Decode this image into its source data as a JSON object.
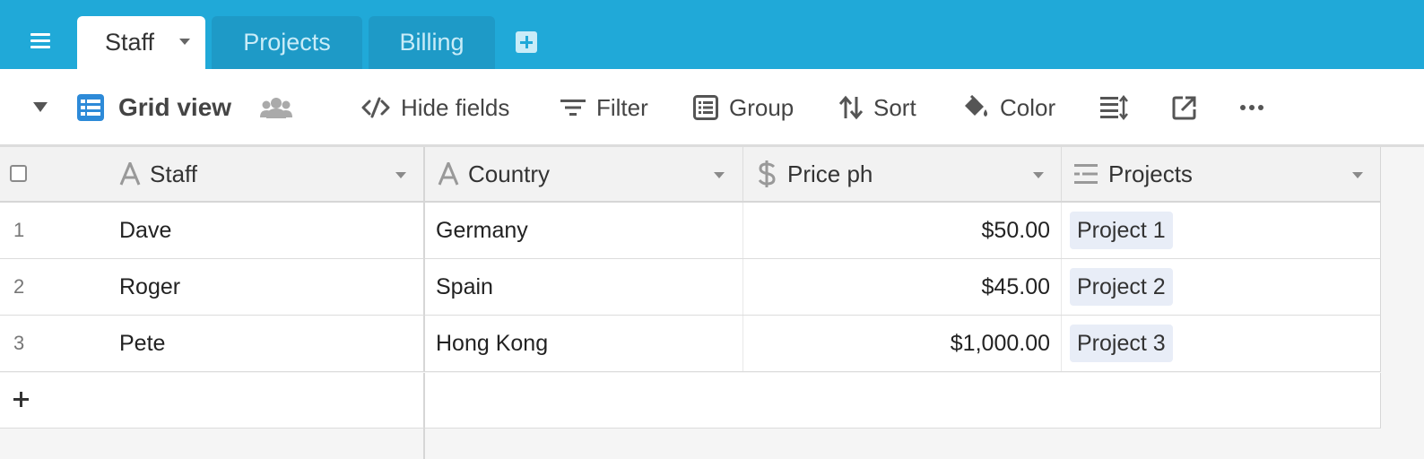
{
  "tabs": {
    "active": {
      "label": "Staff"
    },
    "others": [
      {
        "label": "Projects"
      },
      {
        "label": "Billing"
      }
    ]
  },
  "toolbar": {
    "view_name": "Grid view",
    "hide_fields": "Hide fields",
    "filter": "Filter",
    "group": "Group",
    "sort": "Sort",
    "color": "Color"
  },
  "grid": {
    "columns": [
      {
        "name": "Staff",
        "icon": "text-field-icon"
      },
      {
        "name": "Country",
        "icon": "text-field-icon"
      },
      {
        "name": "Price ph",
        "icon": "currency-field-icon"
      },
      {
        "name": "Projects",
        "icon": "linked-record-icon"
      }
    ],
    "rows": [
      {
        "num": "1",
        "staff": "Dave",
        "country": "Germany",
        "price": "$50.00",
        "project": "Project 1"
      },
      {
        "num": "2",
        "staff": "Roger",
        "country": "Spain",
        "price": "$45.00",
        "project": "Project 2"
      },
      {
        "num": "3",
        "staff": "Pete",
        "country": "Hong Kong",
        "price": "$1,000.00",
        "project": "Project 3"
      }
    ]
  },
  "colors": {
    "brand": "#20a9d8",
    "inactive_tab": "#1e9ac7",
    "grid_icon": "#2d8ad8",
    "chip": "#e8edf7"
  }
}
